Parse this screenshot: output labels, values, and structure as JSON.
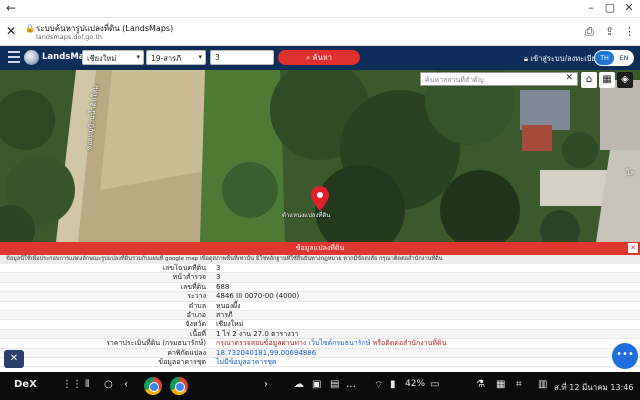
{
  "window": {
    "back_icon": "arrow-left-icon",
    "controls": [
      "minimize-icon",
      "restore-icon",
      "close-icon"
    ]
  },
  "tab": {
    "title": "ระบบค้นหารูปแปลงที่ดิน (LandsMaps)",
    "url": "landsmaps.dol.go.th"
  },
  "navbar": {
    "brand": "LandsMaps",
    "province": "เชียงใหม่",
    "district": "19-สารภี",
    "parcel_input": "3",
    "search_label": "ค้นหา",
    "login_label": "เข้าสู่ระบบ/ลงทะเบียน",
    "lang_th": "TH",
    "lang_en": "EN"
  },
  "map": {
    "search_placeholder": "ค้นหาสถานที่สำคัญ",
    "pin_label": "ตำแหน่งแปลงที่ดิน",
    "road_label_left": "ซอยหมู่บ้านน้ำดิบใหม่",
    "road_label_right": "โล"
  },
  "info": {
    "header": "ข้อมูลแปลงที่ดิน",
    "close": "✕",
    "notice": "ข้อมูลนี้ใช้เพื่อประกอบการแสดงลักษณะรูปแปลงที่ดินร่วมกับแผนที่ google map เพื่อดูสภาพพื้นที่เท่านั้น มิใช่หลักฐานที่ใช้ยืนยันทางกฎหมาย หากมีข้อสงสัย กรุณาติดต่อสำนักงานที่ดิน",
    "rows": [
      {
        "key": "เลขโฉนดที่ดิน",
        "value": "3"
      },
      {
        "key": "หน้าสำรวจ",
        "value": "3"
      },
      {
        "key": "เลขที่ดิน",
        "value": "688"
      },
      {
        "key": "ระวาง",
        "value": "4846 III 0070-00 (4000)"
      },
      {
        "key": "ตำบล",
        "value": "หนองผึ้ง"
      },
      {
        "key": "อำเภอ",
        "value": "สารภี"
      },
      {
        "key": "จังหวัด",
        "value": "เชียงใหม่"
      },
      {
        "key": "เนื้อที่",
        "value": "1 ไร่ 2 งาน 27.0 ตารางวา"
      },
      {
        "key": "ราคาประเมินที่ดิน (กรมธนารักษ์)",
        "value_a": "กรุณาตรวจสอบข้อมูลผ่านทาง",
        "value_b": "เว็บไซต์กรมธนารักษ์",
        "value_c": "หรือติดต่อสำนักงานที่ดิน"
      },
      {
        "key": "ค่าพิกัดแปลง",
        "value": "18.732040181,99.00694886"
      },
      {
        "key": "ข้อมูลอาคารชุด",
        "value": "ไม่มีข้อมูลอาคารชุด"
      }
    ]
  },
  "taskbar": {
    "dex": "DeX",
    "battery": "42%",
    "clock": "ส.ที่ 12 มีนาคม 13:46"
  },
  "colors": {
    "navbar": "#0d2d5a",
    "accent_red": "#e1352f",
    "lang_active": "#1e76d2",
    "link_blue": "#1a62c4"
  }
}
